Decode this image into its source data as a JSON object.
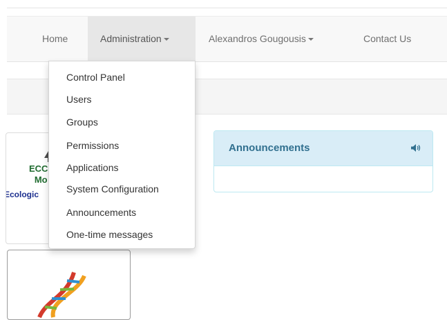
{
  "navbar": {
    "items": [
      {
        "label": "Home"
      },
      {
        "label": "Administration"
      },
      {
        "label": "Alexandros Gougousis"
      },
      {
        "label": "Contact Us"
      }
    ]
  },
  "admin_menu": {
    "items": [
      {
        "label": "Control Panel"
      },
      {
        "label": "Users"
      },
      {
        "label": "Groups"
      },
      {
        "label": "Permissions"
      },
      {
        "label": "Applications"
      },
      {
        "label": "System Configuration"
      },
      {
        "label": "Announcements"
      },
      {
        "label": "One-time messages"
      }
    ]
  },
  "app_cards": [
    {
      "logo_text_line1": "ECC",
      "logo_text_line2": "Mo",
      "caption": "Ecologic"
    },
    {
      "icon": "dna-icon"
    }
  ],
  "announcements_panel": {
    "title": "Announcements",
    "icon": "speaker-icon",
    "heading_bg": "#d9edf7",
    "title_color": "#31708f"
  }
}
